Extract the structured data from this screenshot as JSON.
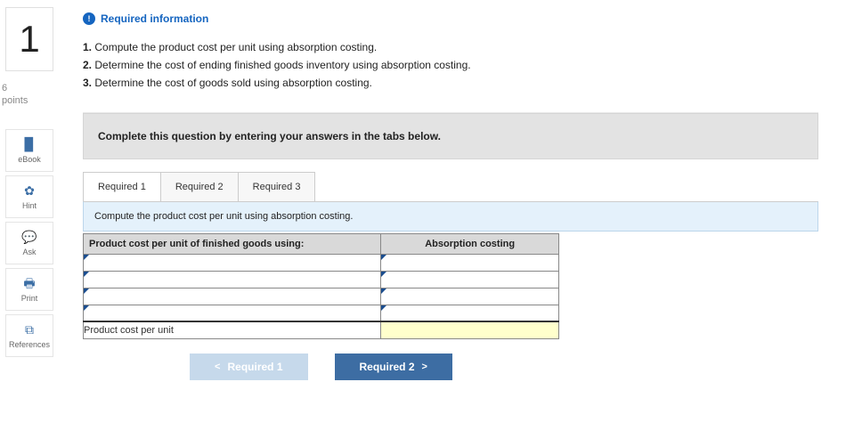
{
  "question": {
    "number": "1",
    "points_value": "6",
    "points_label": "points"
  },
  "required_info_label": "Required information",
  "instructions": [
    {
      "n": "1.",
      "text": "Compute the product cost per unit using absorption costing."
    },
    {
      "n": "2.",
      "text": "Determine the cost of ending finished goods inventory using absorption costing."
    },
    {
      "n": "3.",
      "text": "Determine the cost of goods sold using absorption costing."
    }
  ],
  "tools": {
    "ebook": "eBook",
    "hint": "Hint",
    "ask": "Ask",
    "print": "Print",
    "references": "References"
  },
  "banner": "Complete this question by entering your answers in the tabs below.",
  "tabs": {
    "t1": "Required 1",
    "t2": "Required 2",
    "t3": "Required 3"
  },
  "active_prompt": "Compute the product cost per unit using absorption costing.",
  "table": {
    "header_left": "Product cost per unit of finished goods using:",
    "header_right": "Absorption costing",
    "rows": [
      {
        "label": "",
        "value": ""
      },
      {
        "label": "",
        "value": ""
      },
      {
        "label": "",
        "value": ""
      },
      {
        "label": "",
        "value": ""
      }
    ],
    "total_label": "Product cost per unit",
    "total_value": ""
  },
  "nav": {
    "prev": "Required 1",
    "next": "Required 2"
  }
}
